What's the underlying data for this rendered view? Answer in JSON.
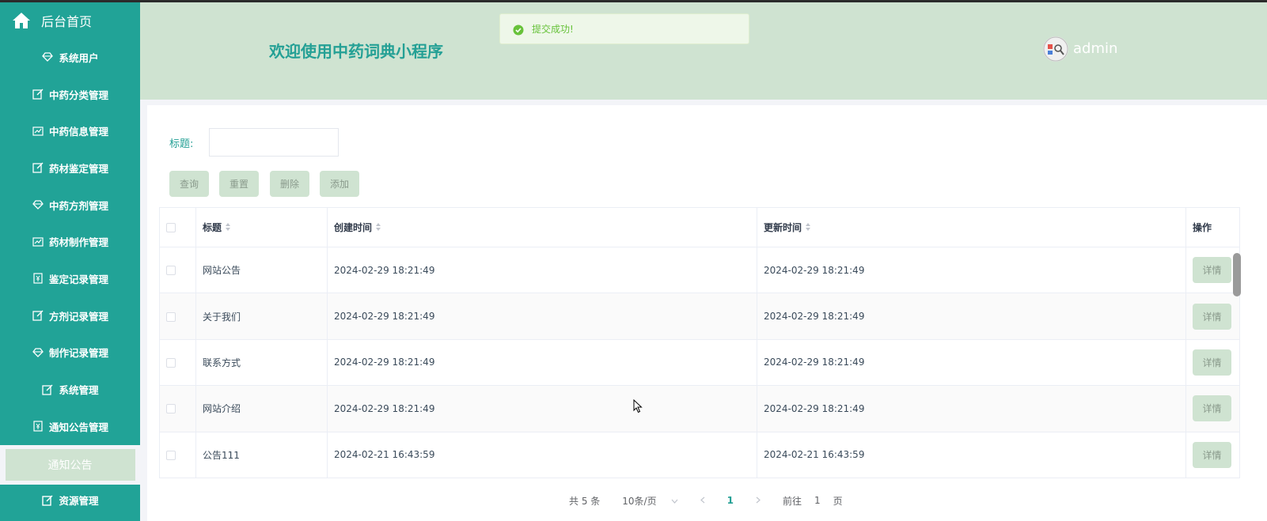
{
  "sidebar": {
    "home_label": "后台首页",
    "items": [
      {
        "label": "系统用户",
        "icon": "diamond-icon"
      },
      {
        "label": "中药分类管理",
        "icon": "edit-icon"
      },
      {
        "label": "中药信息管理",
        "icon": "chart-icon"
      },
      {
        "label": "药材鉴定管理",
        "icon": "edit-icon"
      },
      {
        "label": "中药方剂管理",
        "icon": "diamond-icon"
      },
      {
        "label": "药材制作管理",
        "icon": "chart-icon"
      },
      {
        "label": "鉴定记录管理",
        "icon": "yen-icon"
      },
      {
        "label": "方剂记录管理",
        "icon": "edit-icon"
      },
      {
        "label": "制作记录管理",
        "icon": "diamond-icon"
      },
      {
        "label": "系统管理",
        "icon": "edit-icon"
      },
      {
        "label": "通知公告管理",
        "icon": "yen-icon"
      }
    ],
    "active_sub": "通知公告",
    "bottom_partial": "资源管理"
  },
  "header": {
    "title": "欢迎使用中药词典小程序",
    "username": "admin"
  },
  "toast": {
    "message": "提交成功!"
  },
  "search": {
    "label": "标题:",
    "value": ""
  },
  "buttons": {
    "query": "查询",
    "reset": "重置",
    "delete": "删除",
    "add": "添加"
  },
  "table": {
    "columns": {
      "title": "标题",
      "created": "创建时间",
      "updated": "更新时间",
      "actions": "操作"
    },
    "detail_label": "详情",
    "rows": [
      {
        "title": "网站公告",
        "created": "2024-02-29 18:21:49",
        "updated": "2024-02-29 18:21:49"
      },
      {
        "title": "关于我们",
        "created": "2024-02-29 18:21:49",
        "updated": "2024-02-29 18:21:49"
      },
      {
        "title": "联系方式",
        "created": "2024-02-29 18:21:49",
        "updated": "2024-02-29 18:21:49"
      },
      {
        "title": "网站介绍",
        "created": "2024-02-29 18:21:49",
        "updated": "2024-02-29 18:21:49"
      },
      {
        "title": "公告111",
        "created": "2024-02-21 16:43:59",
        "updated": "2024-02-21 16:43:59"
      }
    ]
  },
  "pager": {
    "total": "共 5 条",
    "page_size": "10条/页",
    "current": "1",
    "goto_prefix": "前往",
    "goto_value": "1",
    "goto_suffix": "页"
  },
  "colors": {
    "sidebar_bg": "#21a397",
    "header_bg": "#cfe3d1",
    "accent": "#24a095",
    "success": "#67c23a"
  }
}
